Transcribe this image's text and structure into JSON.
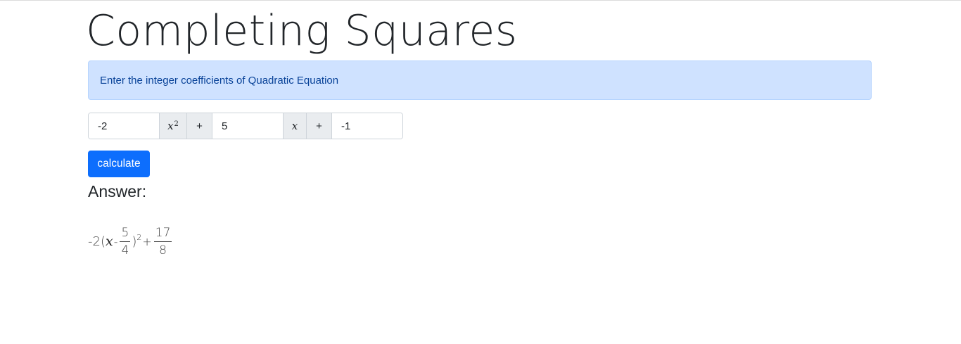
{
  "page": {
    "title": "Completing Squares",
    "instruction": "Enter the integer coefficients of Quadratic Equation"
  },
  "form": {
    "coef_a": "-2",
    "coef_b": "5",
    "coef_c": "-1",
    "var_x2": "x",
    "var_x2_exp": "2",
    "var_x": "x",
    "plus1": "+",
    "plus2": "+",
    "calculate_label": "calculate"
  },
  "answer": {
    "heading": "Answer:",
    "leading": "-2(",
    "var": "x",
    "minus": "-",
    "frac1_num": "5",
    "frac1_den": "4",
    "close": ")",
    "exp": "2",
    "plus": "+",
    "frac2_num": "17",
    "frac2_den": "8"
  },
  "colors": {
    "alert_bg": "#cfe2ff",
    "alert_text": "#084298",
    "primary_button": "#0d6efd",
    "addon_bg": "#e9ecef"
  }
}
